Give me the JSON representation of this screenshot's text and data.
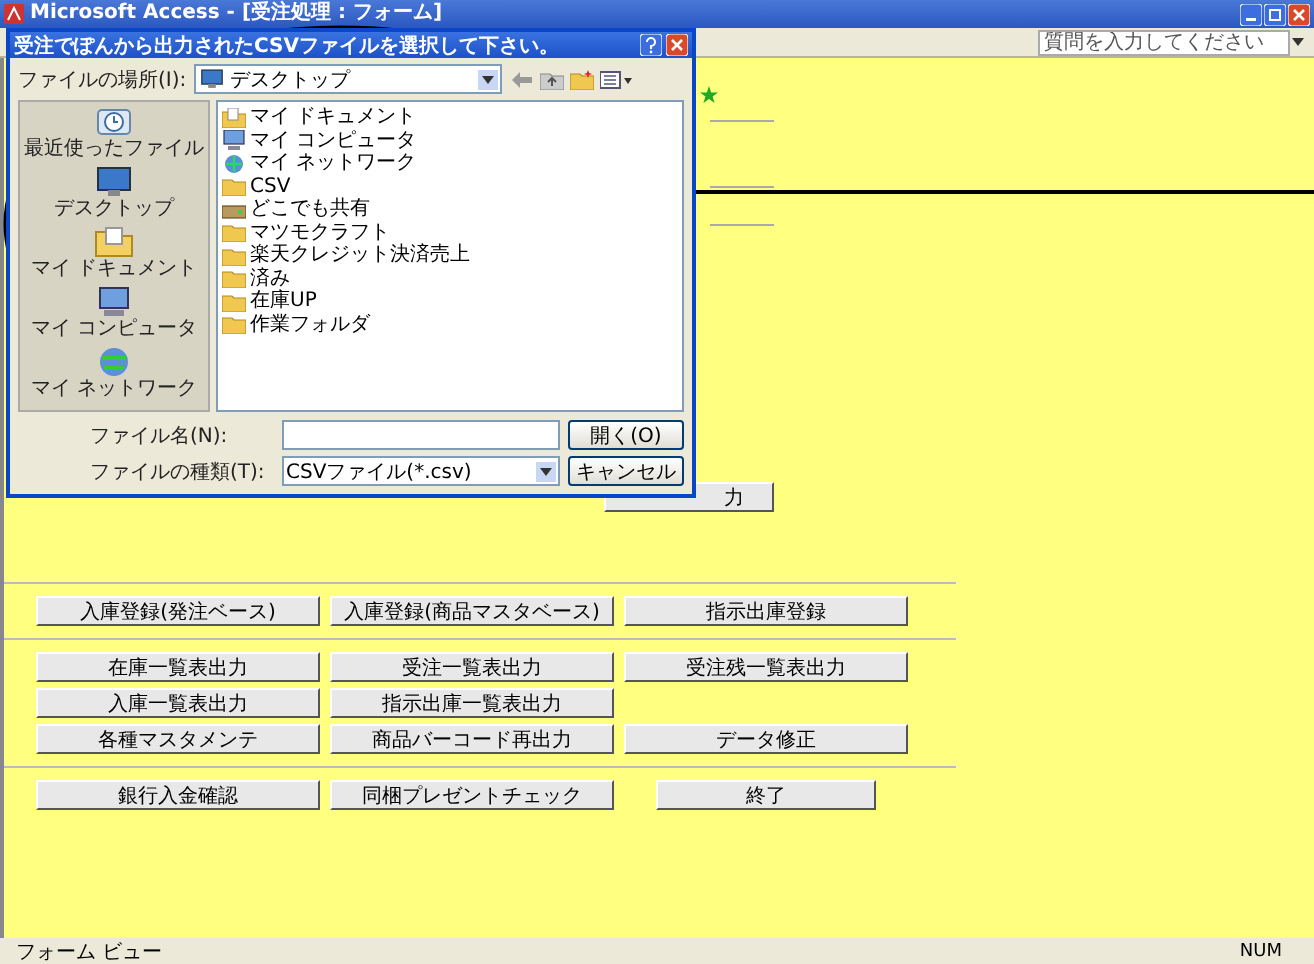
{
  "window": {
    "title": "Microsoft Access - [受注処理 : フォーム]"
  },
  "help_box": {
    "placeholder": "質問を入力してください"
  },
  "dialog": {
    "title": "受注でぽんから出力されたCSVファイルを選択して下さい。",
    "look_in": {
      "label": "ファイルの場所(I):",
      "value": "デスクトップ"
    },
    "places": [
      {
        "label": "最近使ったファイル",
        "kind": "recent"
      },
      {
        "label": "デスクトップ",
        "kind": "desktop"
      },
      {
        "label": "マイ ドキュメント",
        "kind": "documents"
      },
      {
        "label": "マイ コンピュータ",
        "kind": "computer"
      },
      {
        "label": "マイ ネットワーク",
        "kind": "network"
      }
    ],
    "files": [
      {
        "name": "マイ ドキュメント",
        "kind": "documents"
      },
      {
        "name": "マイ コンピュータ",
        "kind": "computer"
      },
      {
        "name": "マイ ネットワーク",
        "kind": "network"
      },
      {
        "name": "CSV",
        "kind": "folder"
      },
      {
        "name": "どこでも共有",
        "kind": "shared"
      },
      {
        "name": "マツモクラフト",
        "kind": "folder"
      },
      {
        "name": "楽天クレジット決済売上",
        "kind": "folder"
      },
      {
        "name": "済み",
        "kind": "folder"
      },
      {
        "name": "在庫UP",
        "kind": "folder"
      },
      {
        "name": "作業フォルダ",
        "kind": "folder"
      }
    ],
    "file_name": {
      "label": "ファイル名(N):"
    },
    "file_type": {
      "label": "ファイルの種類(T):",
      "value": "CSVファイル(*.csv)"
    },
    "buttons": [
      "開く(O)",
      "キャンセル"
    ]
  },
  "form": {
    "hidden_button": "力",
    "button_groups": [
      [
        [
          "入庫登録(発注ベース)",
          "入庫登録(商品マスタベース)",
          "指示出庫登録"
        ]
      ],
      [
        [
          "在庫一覧表出力",
          "受注一覧表出力",
          "受注残一覧表出力"
        ],
        [
          "入庫一覧表出力",
          "指示出庫一覧表出力"
        ],
        [
          "各種マスタメンテ",
          "商品バーコード再出力",
          "データ修正"
        ]
      ],
      [
        [
          "銀行入金確認",
          "同梱プレゼントチェック",
          "終了"
        ]
      ]
    ]
  },
  "status_bar": {
    "left": "フォーム ビュー",
    "right": "NUM"
  }
}
